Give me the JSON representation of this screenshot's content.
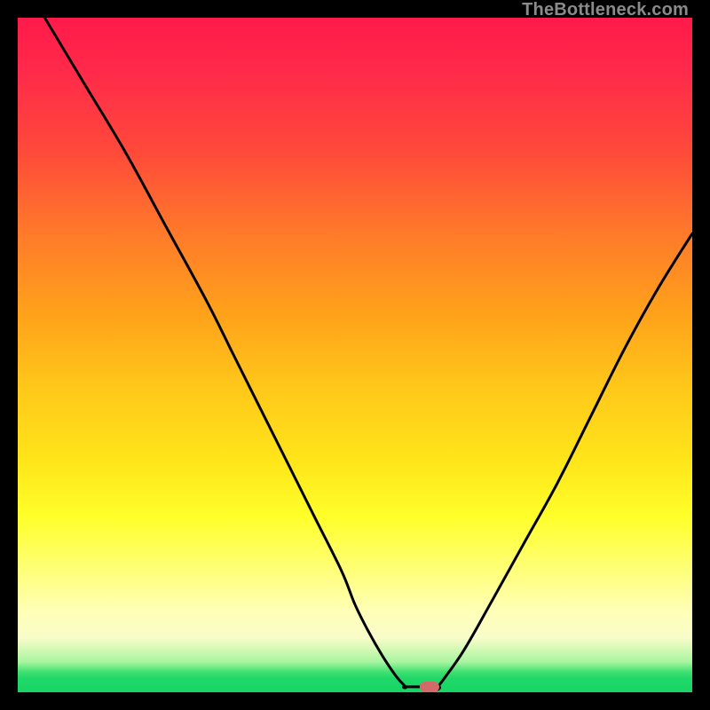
{
  "attribution": "TheBottleneck.com",
  "colors": {
    "frame": "#000000",
    "curve": "#000000",
    "marker": "#d36a6a",
    "gradient_top": "#ff1a4a",
    "gradient_bottom": "#18d566"
  },
  "chart_data": {
    "type": "line",
    "title": "",
    "xlabel": "",
    "ylabel": "",
    "xlim": [
      0,
      100
    ],
    "ylim": [
      0,
      100
    ],
    "annotations": [
      {
        "text": "TheBottleneck.com",
        "pos": "top-right"
      }
    ],
    "series": [
      {
        "name": "left-branch",
        "x": [
          4,
          10,
          16,
          22,
          28,
          32,
          36,
          40,
          44,
          48,
          50,
          52,
          54,
          56,
          57.5
        ],
        "y": [
          100,
          90,
          80,
          69,
          58,
          50,
          42,
          34,
          26,
          18,
          13,
          9,
          5.5,
          2.5,
          0.8
        ]
      },
      {
        "name": "floor",
        "x": [
          57.5,
          62.3
        ],
        "y": [
          0.8,
          0.8
        ]
      },
      {
        "name": "right-branch",
        "x": [
          62.3,
          66,
          70,
          75,
          80,
          85,
          90,
          95,
          100
        ],
        "y": [
          0.8,
          6,
          13,
          22,
          31,
          41,
          51,
          60,
          68
        ]
      }
    ],
    "marker": {
      "x": 61,
      "y": 0.8,
      "shape": "pill",
      "color": "#d36a6a"
    },
    "grid": false,
    "legend": false
  }
}
